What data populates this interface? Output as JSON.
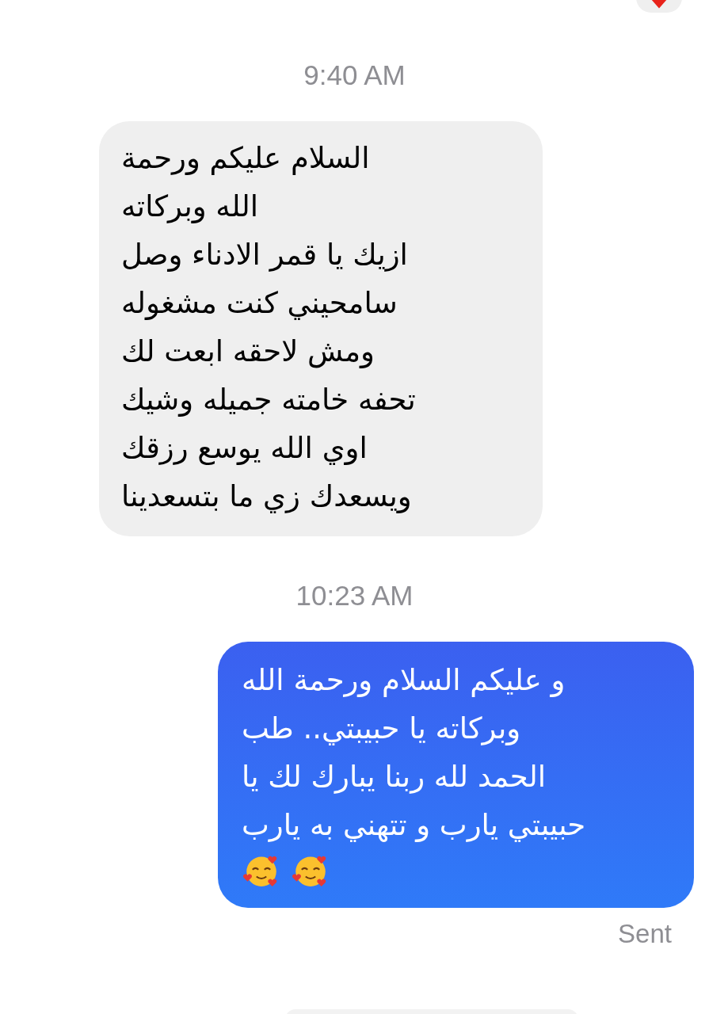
{
  "top_reaction": {
    "kind": "heart"
  },
  "messages": [
    {
      "kind": "timestamp",
      "text": "9:40 AM"
    },
    {
      "kind": "incoming",
      "text": "السلام عليكم ورحمة\nالله وبركاته\nازيك يا قمر الادناء وصل\nسامحيني كنت مشغوله\nومش لاحقه ابعت لك\nتحفه خامته جميله وشيك\nاوي الله يوسع رزقك\nويسعدك  زي ما بتسعدينا"
    },
    {
      "kind": "timestamp",
      "text": "10:23 AM"
    },
    {
      "kind": "outgoing",
      "text": "و عليكم السلام ورحمة الله\nوبركاته يا حبيبتي.. طب\nالحمد لله ربنا يبارك لك يا\nحبيبتي يارب و تتهني به يارب",
      "emojis": [
        {
          "kind": "smiling-hearts"
        },
        {
          "kind": "smiling-hearts"
        }
      ]
    },
    {
      "kind": "status",
      "text": "Sent"
    }
  ]
}
